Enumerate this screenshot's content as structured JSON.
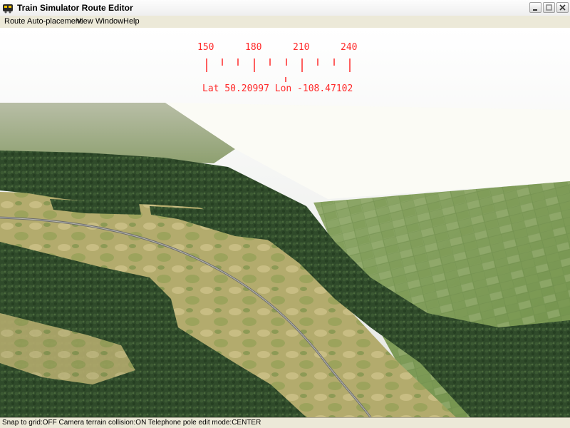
{
  "window": {
    "title": "Train Simulator Route Editor",
    "app_icon": "train-icon",
    "buttons": [
      "minimize-icon",
      "maximize-icon",
      "close-icon"
    ]
  },
  "menu": {
    "items": [
      "Route",
      "Auto-placement",
      "View",
      "Window",
      "Help"
    ]
  },
  "compass": {
    "tick_labels": [
      "150",
      "180",
      "210",
      "240"
    ],
    "latitude": "50.20997",
    "longitude": "-108.47102",
    "readout": "Lat 50.20997 Lon -108.47102",
    "color": "#ff2a2a"
  },
  "statusbar": {
    "text": "Snap to grid:OFF Camera terrain collision:ON Telephone pole edit mode:CENTER"
  }
}
